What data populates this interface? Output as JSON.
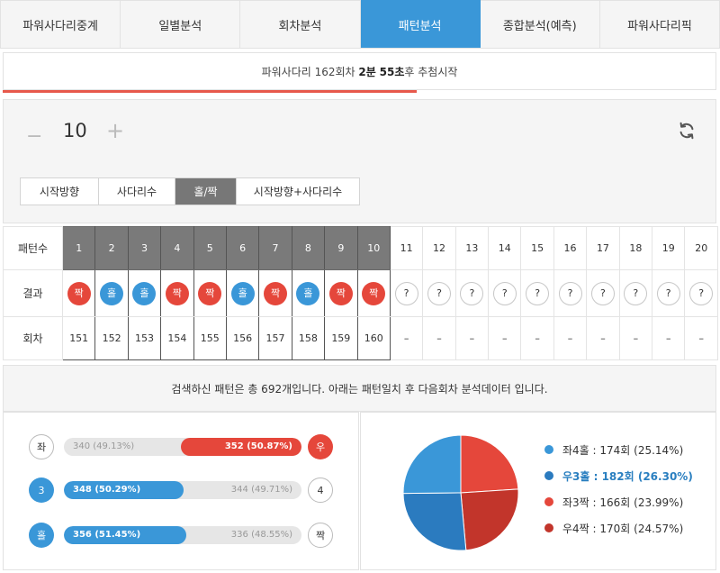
{
  "tabs": [
    "파워사다리중계",
    "일별분석",
    "회차분석",
    "패턴분석",
    "종합분석(예측)",
    "파워사다리픽"
  ],
  "status": {
    "prefix": "파워사다리 162회차",
    "min": "2분",
    "sec": "55초",
    "suffix": "후 추첨시작",
    "progress_fraction": 0.58
  },
  "counter": {
    "minus": "−",
    "value": "10",
    "plus": "+"
  },
  "filters": [
    "시작방향",
    "사다리수",
    "홀/짝",
    "시작방향+사다리수"
  ],
  "table": {
    "label_pattern": "패턴수",
    "label_result": "결과",
    "label_round": "회차",
    "numbers": [
      "1",
      "2",
      "3",
      "4",
      "5",
      "6",
      "7",
      "8",
      "9",
      "10",
      "11",
      "12",
      "13",
      "14",
      "15",
      "16",
      "17",
      "18",
      "19",
      "20"
    ],
    "results": [
      {
        "text": "짝",
        "color": "red"
      },
      {
        "text": "홀",
        "color": "blue"
      },
      {
        "text": "홀",
        "color": "blue"
      },
      {
        "text": "짝",
        "color": "red"
      },
      {
        "text": "짝",
        "color": "red"
      },
      {
        "text": "홀",
        "color": "blue"
      },
      {
        "text": "짝",
        "color": "red"
      },
      {
        "text": "홀",
        "color": "blue"
      },
      {
        "text": "짝",
        "color": "red"
      },
      {
        "text": "짝",
        "color": "red"
      },
      {
        "text": "?",
        "color": "empty"
      },
      {
        "text": "?",
        "color": "empty"
      },
      {
        "text": "?",
        "color": "empty"
      },
      {
        "text": "?",
        "color": "empty"
      },
      {
        "text": "?",
        "color": "empty"
      },
      {
        "text": "?",
        "color": "empty"
      },
      {
        "text": "?",
        "color": "empty"
      },
      {
        "text": "?",
        "color": "empty"
      },
      {
        "text": "?",
        "color": "empty"
      },
      {
        "text": "?",
        "color": "empty"
      }
    ],
    "rounds": [
      "151",
      "152",
      "153",
      "154",
      "155",
      "156",
      "157",
      "158",
      "159",
      "160",
      "–",
      "–",
      "–",
      "–",
      "–",
      "–",
      "–",
      "–",
      "–",
      "–"
    ]
  },
  "search_result": "검색하신 패턴은 총 692개입니다. 아래는 패턴일치 후 다음회차 분석데이터 입니다.",
  "stats": [
    {
      "left_label": "좌",
      "left_style": "w",
      "right_label": "우",
      "right_style": "r",
      "left_text": "340 (49.13%)",
      "right_text": "352 (50.87%)",
      "fill_side": "right",
      "fill_color": "r",
      "fill_percent": 50.87
    },
    {
      "left_label": "3",
      "left_style": "b",
      "right_label": "4",
      "right_style": "w",
      "left_text": "348 (50.29%)",
      "right_text": "344 (49.71%)",
      "fill_side": "left",
      "fill_color": "b",
      "fill_percent": 50.29
    },
    {
      "left_label": "홀",
      "left_style": "b",
      "right_label": "짝",
      "right_style": "w",
      "left_text": "356 (51.45%)",
      "right_text": "336 (48.55%)",
      "fill_side": "left",
      "fill_color": "b",
      "fill_percent": 51.45
    }
  ],
  "chart_data": {
    "type": "pie",
    "slices": [
      {
        "label": "좌4홀 : 174회 (25.14%)",
        "value": 174,
        "color": "#3a97d8"
      },
      {
        "label": "우3홀 : 182회 (26.30%)",
        "value": 182,
        "color": "#2b7bbf",
        "highlight": true
      },
      {
        "label": "좌3짝 : 166회 (23.99%)",
        "value": 166,
        "color": "#e5473b"
      },
      {
        "label": "우4짝 : 170회 (24.57%)",
        "value": 170,
        "color": "#c2352b"
      }
    ]
  }
}
